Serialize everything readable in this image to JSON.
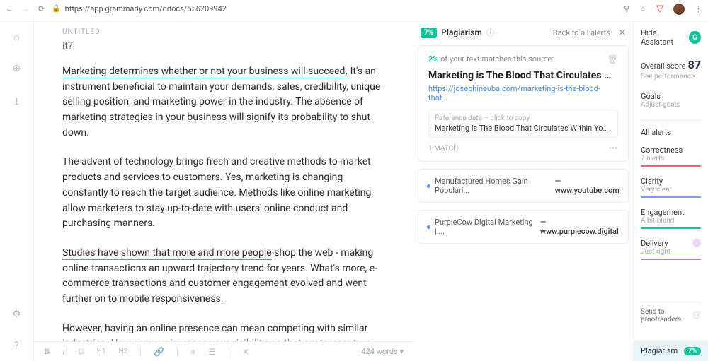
{
  "browser": {
    "url": "https://app.grammarly.com/ddocs/556209942"
  },
  "doc": {
    "title": "UNTITLED",
    "frag": "it?",
    "p1_u": "Marketing determines whether or not your business will succeed.",
    "p1_rest": " It's an instrument beneficial to maintain your demands, sales, credibility, unique selling position, and marketing power in the industry. The absence of marketing strategies in your business will signify its probability to shut down.",
    "p2": "The advent of technology brings fresh and creative methods to market products and services to customers. Yes, marketing is changing constantly to reach the target audience. Methods like online marketing allow marketers to stay up-to-date with users' online conduct and purchasing manners.",
    "p3_u": "Studies have shown that more and more people",
    "p3_rest": " shop the web - making online transactions an upward trajectory trend for years. What's more, e-commerce transactions and customer engagement evolved and went further on to mobile responsiveness.",
    "p4": "However, having an online presence can mean competing with similar",
    "p4_cut": "industries. How can you increase your visibility, so that customers turn",
    "word_count": "424 words"
  },
  "toolbar": {
    "b": "B",
    "i": "I",
    "u": "U",
    "h1": "H1",
    "h2": "H2"
  },
  "mid": {
    "badge": "7%",
    "label": "Plagiarism",
    "back": "Back to all alerts",
    "match_pct": "2%",
    "match_text": " of your text matches this source:",
    "src_title": "Marketing is The Blood That Circulates Withir",
    "src_url": "https://josephineuba.com/marketing-is-the-blood-that...",
    "ref_label": "Reference data – click to copy",
    "ref_text": "Marketing is The Blood That Circulates Within Your Entire .... h...",
    "match_count": "1 MATCH",
    "rows": [
      {
        "title": "Manufactured Homes Gain Populari...",
        "domain": "— www.youtube.com"
      },
      {
        "title": "PurpleCow Digital Marketing | ...",
        "domain": "— www.purplecow.digital"
      }
    ]
  },
  "right": {
    "hide": "Hide Assistant",
    "score_label": "Overall score",
    "score": "87",
    "see_perf": "See performance",
    "goals": "Goals",
    "adjust": "Adjust goals",
    "all_alerts": "All alerts",
    "metrics": {
      "correctness": {
        "name": "Correctness",
        "val": "7 alerts"
      },
      "clarity": {
        "name": "Clarity",
        "val": "Very clear"
      },
      "engagement": {
        "name": "Engagement",
        "val": "A bit bland"
      },
      "delivery": {
        "name": "Delivery",
        "val": "Just right"
      }
    },
    "proof": "Send to proofreaders",
    "plag": "Plagiarism",
    "plag_pct": "7%"
  }
}
